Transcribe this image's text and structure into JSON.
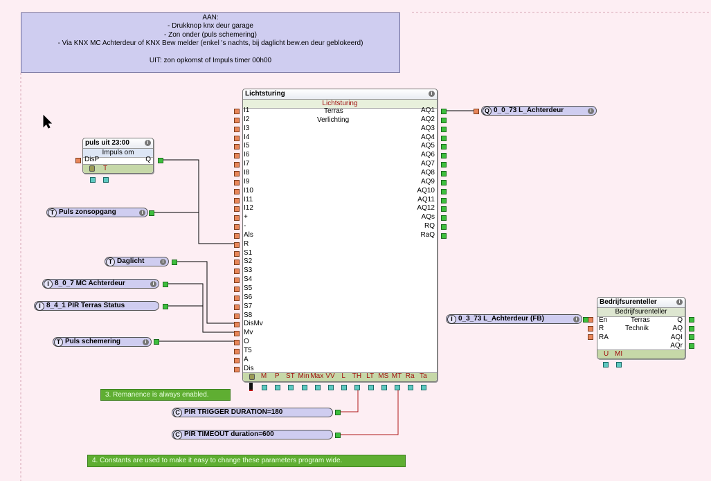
{
  "comment_lines": [
    "AAN:",
    "- Drukknop knx deur garage",
    "- Zon onder (puls schemering)",
    "- Via KNX MC Achterdeur of KNX Bew melder (enkel 's nachts, bij daglicht bew.en deur geblokeerd)",
    "",
    "UIT: zon opkomst of Impuls timer 00h00"
  ],
  "notes": {
    "remanence": "3. Remanence is always enabled.",
    "constants": "4. Constants are used to make it easy to change these parameters program wide."
  },
  "info_glyph": "i",
  "licht": {
    "title": "Lichtsturing",
    "subtitle": "Lichtsturing",
    "center_text": [
      "Terras",
      "Verlichting"
    ],
    "inputs": [
      "I1",
      "I2",
      "I3",
      "I4",
      "I5",
      "I6",
      "I7",
      "I8",
      "I9",
      "I10",
      "I11",
      "I12",
      "+",
      "-",
      "Als",
      "R",
      "S1",
      "S2",
      "S3",
      "S4",
      "S5",
      "S6",
      "S7",
      "S8",
      "DisMv",
      "Mv",
      "O",
      "T5",
      "A",
      "Dis"
    ],
    "outputs": [
      "AQ1",
      "AQ2",
      "AQ3",
      "AQ4",
      "AQ5",
      "AQ6",
      "AQ7",
      "AQ8",
      "AQ9",
      "AQ10",
      "AQ11",
      "AQ12",
      "AQs",
      "RQ",
      "RaQ"
    ],
    "params": [
      "M",
      "P",
      "ST",
      "Min",
      "Max",
      "VV",
      "L",
      "TH",
      "LT",
      "MS",
      "MT",
      "Ra",
      "Ta"
    ]
  },
  "puls": {
    "title": "puls uit 23:00",
    "subtitle": "Impuls om",
    "input": "DisP",
    "output": "Q",
    "params": [
      "T"
    ]
  },
  "bedrijf": {
    "title": "Bedrijfsurenteller",
    "subtitle": "Bedrijfsurenteller",
    "center_text": [
      "Terras",
      "Technik"
    ],
    "inputs": [
      "En",
      "R",
      "RA"
    ],
    "outputs": [
      "Q",
      "AQ",
      "AQI",
      "AQr"
    ],
    "params": [
      "U",
      "MI"
    ]
  },
  "pills": {
    "zonsopgang": {
      "badge": "T",
      "label": "Puls zonsopgang"
    },
    "daglicht": {
      "badge": "T",
      "label": "Daglicht"
    },
    "mc_achterdeur": {
      "badge": "I",
      "label": "8_0_7 MC Achterdeur"
    },
    "pir_terras": {
      "badge": "I",
      "label": "8_4_1 PIR Terras Status"
    },
    "schemering": {
      "badge": "T",
      "label": "Puls schemering"
    },
    "pir_trigger": {
      "badge": "C",
      "label": "PIR TRIGGER DURATION=180"
    },
    "pir_timeout": {
      "badge": "C",
      "label": "PIR TIMEOUT duration=600"
    },
    "out_l_achterdeur": {
      "badge": "Q",
      "label": "0_0_73 L_Achterdeur"
    },
    "in_l_achterdeur_fb": {
      "badge": "I",
      "label": "0_3_73 L_Achterdeur (FB)"
    }
  },
  "colors": {
    "background": "#fdeef3",
    "comment": "#cfcdf0",
    "note": "#5fae32",
    "wire": "#000000",
    "param_wire": "#b01818"
  }
}
